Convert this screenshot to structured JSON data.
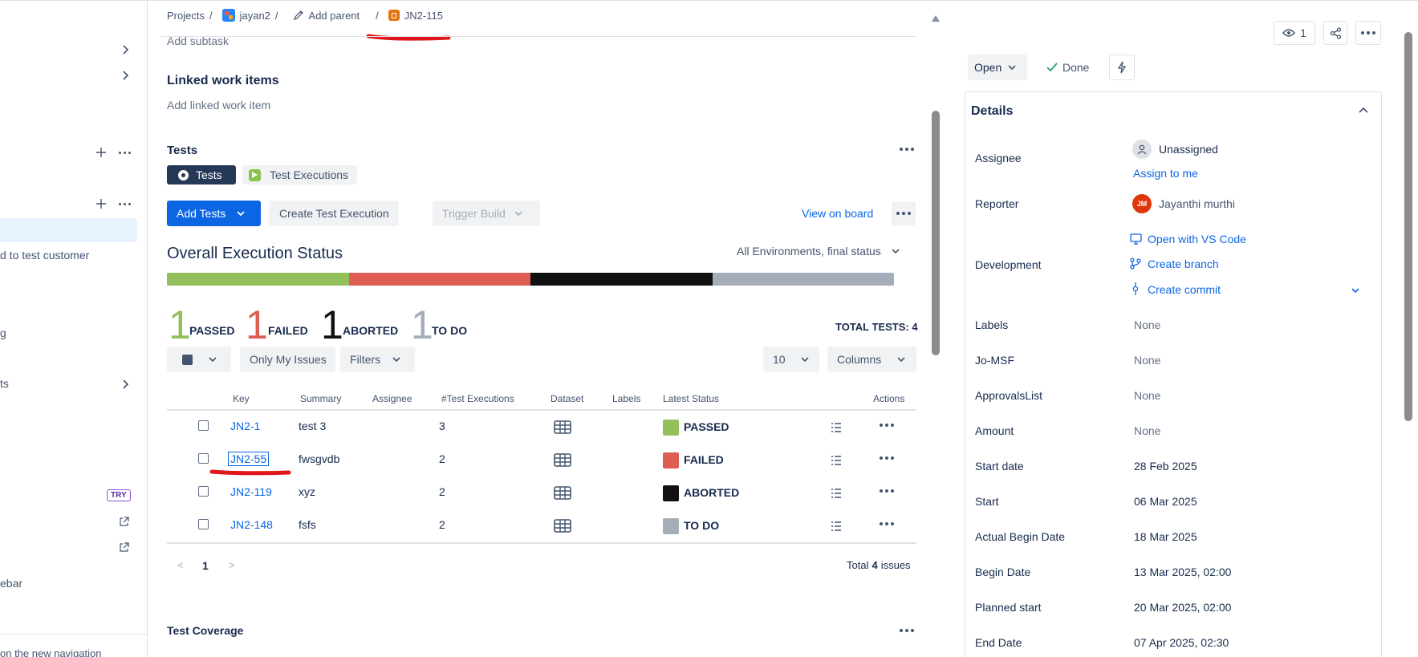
{
  "sidebar": {
    "items": [
      {
        "label": "d to test customer"
      },
      {
        "label": "g"
      },
      {
        "label": "ts"
      },
      {
        "label": "ebar"
      },
      {
        "label": "on the new navigation"
      }
    ],
    "try_badge": "TRY"
  },
  "breadcrumb": {
    "projects": "Projects",
    "sep": "/",
    "project": "jayan2",
    "add_parent": "Add parent",
    "issue": "JN2-115"
  },
  "main": {
    "add_subtask": "Add subtask",
    "linked_title": "Linked work items",
    "add_linked": "Add linked work item",
    "tests_title": "Tests",
    "tabs": [
      {
        "label": "Tests"
      },
      {
        "label": "Test Executions"
      }
    ],
    "toolbar": {
      "add_tests": "Add Tests",
      "create_exec": "Create Test Execution",
      "trigger_build": "Trigger Build",
      "view_board": "View on board"
    },
    "overall_title": "Overall Execution Status",
    "env_select": "All Environments, final status",
    "counts": [
      {
        "num": "1",
        "label": "PASSED",
        "color": "#94c05c"
      },
      {
        "num": "1",
        "label": "FAILED",
        "color": "#de5d52"
      },
      {
        "num": "1",
        "label": "ABORTED",
        "color": "#111111"
      },
      {
        "num": "1",
        "label": "TO DO",
        "color": "#a5adba"
      }
    ],
    "total_tests": "TOTAL TESTS: 4",
    "filters": {
      "only_mine": "Only My Issues",
      "filters": "Filters",
      "page_size": "10",
      "columns": "Columns"
    },
    "columns": [
      "Key",
      "Summary",
      "Assignee",
      "#Test Executions",
      "Dataset",
      "Labels",
      "Latest Status",
      "Actions"
    ],
    "rows": [
      {
        "key": "JN2-1",
        "summary": "test 3",
        "executions": "3",
        "status": "PASSED",
        "status_color": "#94c05c"
      },
      {
        "key": "JN2-55",
        "summary": "fwsgvdb",
        "executions": "2",
        "status": "FAILED",
        "status_color": "#de5d52"
      },
      {
        "key": "JN2-119",
        "summary": "xyz",
        "executions": "2",
        "status": "ABORTED",
        "status_color": "#111111"
      },
      {
        "key": "JN2-148",
        "summary": "fsfs",
        "executions": "2",
        "status": "TO DO",
        "status_color": "#a5adba"
      }
    ],
    "pagination": {
      "prev": "<",
      "page": "1",
      "next": ">"
    },
    "total_issues_prefix": "Total",
    "total_issues_count": "4",
    "total_issues_suffix": "issues",
    "coverage_title": "Test Coverage"
  },
  "panel": {
    "watchers": "1",
    "status": "Open",
    "done": "Done",
    "details_title": "Details",
    "fields": {
      "assignee_label": "Assignee",
      "assignee_value": "Unassigned",
      "assign_me": "Assign to me",
      "reporter_label": "Reporter",
      "reporter_initials": "JM",
      "reporter_value": "Jayanthi murthi",
      "development_label": "Development",
      "open_vscode": "Open with VS Code",
      "create_branch": "Create branch",
      "create_commit": "Create commit"
    },
    "rows": [
      {
        "label": "Labels",
        "value": "None"
      },
      {
        "label": "Jo-MSF",
        "value": "None"
      },
      {
        "label": "ApprovalsList",
        "value": "None"
      },
      {
        "label": "Amount",
        "value": "None"
      },
      {
        "label": "Start date",
        "value": "28 Feb 2025"
      },
      {
        "label": "Start",
        "value": "06 Mar 2025"
      },
      {
        "label": "Actual Begin Date",
        "value": "18 Mar 2025"
      },
      {
        "label": "Begin Date",
        "value": "13 Mar 2025, 02:00"
      },
      {
        "label": "Planned start",
        "value": "20 Mar 2025, 02:00"
      },
      {
        "label": "End Date",
        "value": "07 Apr 2025, 02:30"
      }
    ]
  },
  "colors": {
    "primary": "#0c66e4",
    "annotation_red": "#e3161b",
    "passed": "#94c05c",
    "failed": "#de5d52",
    "aborted": "#111111",
    "todo": "#a5adba"
  }
}
